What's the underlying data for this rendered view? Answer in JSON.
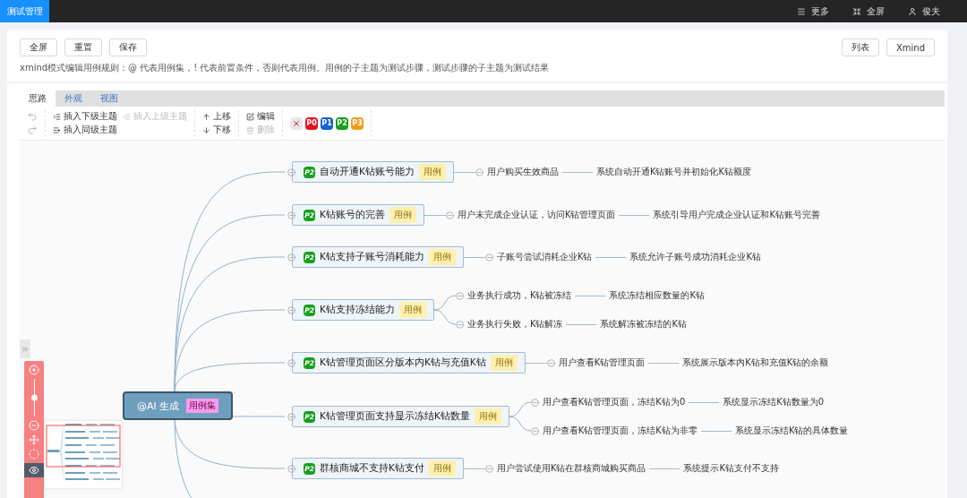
{
  "top_bar": {
    "tab": {
      "label": "测试管理",
      "selected": true
    },
    "actions": [
      {
        "kind": "menu",
        "label": "更多"
      },
      {
        "kind": "fullscreen",
        "label": "全屏"
      },
      {
        "kind": "user",
        "label": "俊夫"
      }
    ]
  },
  "header": {
    "left_buttons": [
      "全屏",
      "重置",
      "保存"
    ],
    "right_buttons": [
      "列表",
      "Xmind"
    ],
    "hint": "xmind模式编辑用例规则：@ 代表用例集，! 代表前置条件，否则代表用例。用例的子主题为测试步骤，测试步骤的子主题为测试结果"
  },
  "editor_tabs": [
    {
      "label": "思路",
      "selected": true
    },
    {
      "label": "外观",
      "selected": false
    },
    {
      "label": "视图",
      "selected": false
    }
  ],
  "toolbar": {
    "groups": [
      [
        {
          "kind": "undo",
          "disabled": true
        },
        {
          "kind": "redo",
          "disabled": true
        }
      ],
      [
        {
          "kind": "insert-child",
          "label": "插入下级主题",
          "disabled": false
        },
        {
          "kind": "insert-parent",
          "label": "插入上级主题",
          "disabled": true
        },
        {
          "kind": "insert-sibling",
          "label": "插入同级主题",
          "disabled": false
        }
      ],
      [
        {
          "kind": "move-up",
          "label": "上移",
          "disabled": false
        },
        {
          "kind": "move-down",
          "label": "下移",
          "disabled": false
        }
      ],
      [
        {
          "kind": "edit",
          "label": "编辑",
          "disabled": false
        },
        {
          "kind": "delete",
          "label": "删除",
          "disabled": true
        }
      ]
    ],
    "priorities": [
      {
        "kind": "clear",
        "color": "#e8e8e8"
      },
      {
        "kind": "priority",
        "label": "P0",
        "color": "#e3141c"
      },
      {
        "kind": "priority",
        "label": "P1",
        "color": "#1462d6"
      },
      {
        "kind": "priority",
        "label": "P2",
        "color": "#16a01c"
      },
      {
        "kind": "priority",
        "label": "P3",
        "color": "#f39a1c"
      }
    ]
  },
  "mind_map": {
    "root": {
      "label": "@AI 生成",
      "tag": "用例集"
    },
    "branches": [
      {
        "priority": {
          "label": "P2",
          "color": "#16a01c"
        },
        "title": "自动开通K钻账号能力",
        "tag": "用例",
        "steps": [
          {
            "text": "用户购买生效商品",
            "result": "系统自动开通K钻账号并初始化K钻额度"
          }
        ]
      },
      {
        "priority": {
          "label": "P2",
          "color": "#16a01c"
        },
        "title": "K钻账号的完善",
        "tag": "用例",
        "steps": [
          {
            "text": "用户未完成企业认证，访问K钻管理页面",
            "result": "系统引导用户完成企业认证和K钻账号完善"
          }
        ]
      },
      {
        "priority": {
          "label": "P2",
          "color": "#16a01c"
        },
        "title": "K钻支持子账号消耗能力",
        "tag": "用例",
        "steps": [
          {
            "text": "子账号尝试消耗企业K钻",
            "result": "系统允许子账号成功消耗企业K钻"
          }
        ]
      },
      {
        "priority": {
          "label": "P2",
          "color": "#16a01c"
        },
        "title": "K钻支持冻结能力",
        "tag": "用例",
        "steps": [
          {
            "text": "业务执行成功，K钻被冻结",
            "result": "系统冻结相应数量的K钻"
          },
          {
            "text": "业务执行失败，K钻解冻",
            "result": "系统解冻被冻结的K钻"
          }
        ]
      },
      {
        "priority": {
          "label": "P2",
          "color": "#16a01c"
        },
        "title": "K钻管理页面区分版本内K钻与充值K钻",
        "tag": "用例",
        "steps": [
          {
            "text": "用户查看K钻管理页面",
            "result": "系统展示版本内K钻和充值K钻的余额"
          }
        ]
      },
      {
        "priority": {
          "label": "P2",
          "color": "#16a01c"
        },
        "title": "K钻管理页面支持显示冻结K钻数量",
        "tag": "用例",
        "steps": [
          {
            "text": "用户查看K钻管理页面，冻结K钻为0",
            "result": "系统显示冻结K钻数量为0"
          },
          {
            "text": "用户查看K钻管理页面，冻结K钻为非零",
            "result": "系统显示冻结K钻的具体数量"
          }
        ]
      },
      {
        "priority": {
          "label": "P2",
          "color": "#16a01c"
        },
        "title": "群核商城不支持K钻支付",
        "tag": "用例",
        "steps": [
          {
            "text": "用户尝试使用K钻在群核商城购买商品",
            "result": "系统提示K钻支付不支持"
          }
        ]
      }
    ]
  },
  "zoom": {
    "level": 0.5
  }
}
